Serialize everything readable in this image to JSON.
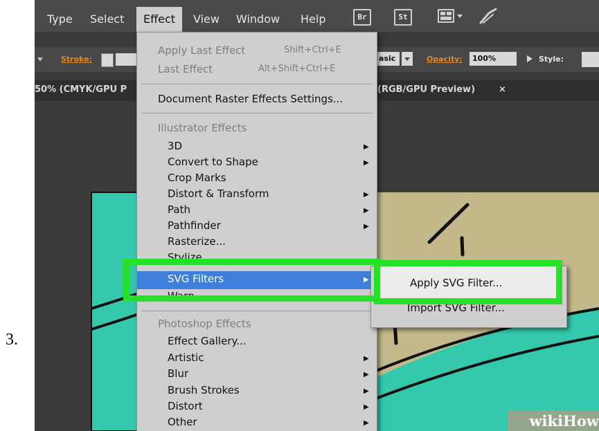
{
  "step_number": "3.",
  "menubar": {
    "items": [
      "Type",
      "Select",
      "Effect",
      "View",
      "Window",
      "Help"
    ],
    "icons": [
      "Br",
      "St",
      "arrange-documents-icon",
      "gpu-performance-icon"
    ]
  },
  "control_bar": {
    "stroke_label": "Stroke:",
    "style_value": "asic",
    "opacity_label": "Opacity:",
    "opacity_value": "100%",
    "style_label": "Style:"
  },
  "tabs": {
    "left": "50% (CMYK/GPU P",
    "right": "(RGB/GPU Preview)",
    "close": "×"
  },
  "effect_menu": {
    "apply_last": {
      "label": "Apply Last Effect",
      "shortcut": "Shift+Ctrl+E"
    },
    "last": {
      "label": "Last Effect",
      "shortcut": "Alt+Shift+Ctrl+E"
    },
    "raster_settings": "Document Raster Effects Settings...",
    "illustrator_header": "Illustrator Effects",
    "illustrator_items": [
      "3D",
      "Convert to Shape",
      "Crop Marks",
      "Distort & Transform",
      "Path",
      "Pathfinder",
      "Rasterize...",
      "Stylize",
      "SVG Filters",
      "Warp"
    ],
    "photoshop_header": "Photoshop Effects",
    "photoshop_items": [
      "Effect Gallery...",
      "Artistic",
      "Blur",
      "Brush Strokes",
      "Distort",
      "Other"
    ]
  },
  "svg_submenu": {
    "apply": "Apply SVG Filter...",
    "import": "Import SVG Filter..."
  },
  "watermark": {
    "part1": "wiki",
    "part2": "How"
  },
  "colors": {
    "highlight": "#3e7fd9",
    "green_box": "#27e028",
    "teal": "#34c9ad",
    "tan": "#c4b98a",
    "stroke_orange": "#e0892a"
  }
}
